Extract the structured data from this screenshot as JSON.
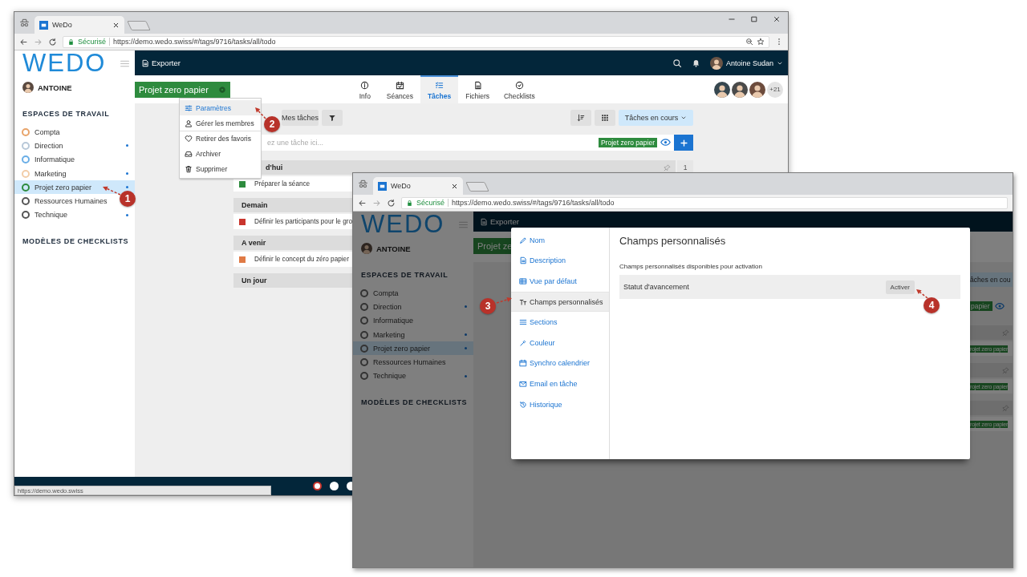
{
  "browser_1": {
    "tab": {
      "title": "WeDo"
    },
    "address_bar": {
      "security": "Sécurisé",
      "url": "https://demo.wedo.swiss/#/tags/9716/tasks/all/todo"
    },
    "sidebar": {
      "logo": "WEDO",
      "user": "ANTOINE",
      "section_title": "ESPACES DE TRAVAIL",
      "items": [
        {
          "label": "Compta",
          "color": "#e8a46a",
          "unread": false,
          "selected": false
        },
        {
          "label": "Direction",
          "color": "#b8c8d8",
          "unread": true,
          "selected": false
        },
        {
          "label": "Informatique",
          "color": "#6aaee6",
          "unread": false,
          "selected": false
        },
        {
          "label": "Marketing",
          "color": "#f2cda8",
          "unread": true,
          "selected": false
        },
        {
          "label": "Projet zero papier",
          "color": "#2e8b3e",
          "unread": true,
          "selected": true
        },
        {
          "label": "Ressources Humaines",
          "color": "#555555",
          "unread": false,
          "selected": false
        },
        {
          "label": "Technique",
          "color": "#555555",
          "unread": true,
          "selected": false
        }
      ],
      "footer_title": "MODÈLES DE CHECKLISTS"
    },
    "topbar": {
      "export": "Exporter",
      "user": "Antoine Sudan"
    },
    "project_tag": "Projet zero papier",
    "tabs": [
      {
        "label": "Info",
        "selected": false
      },
      {
        "label": "Séances",
        "selected": false
      },
      {
        "label": "Tâches",
        "selected": true
      },
      {
        "label": "Fichiers",
        "selected": false
      },
      {
        "label": "Checklists",
        "selected": false
      }
    ],
    "members_more": "+21",
    "toolbar": {
      "my_tasks": "Mes tâches",
      "view_filter": "Tâches en cours"
    },
    "task_input": {
      "placeholder": "ez une tâche ici...",
      "tag": "Projet zero papier"
    },
    "sections": [
      {
        "title": "d'hui",
        "count": "1",
        "tasks": [
          {
            "title": "Préparer la séance",
            "color": "#2e8b3e"
          }
        ]
      },
      {
        "title": "Demain",
        "tasks": [
          {
            "title": "Définir les participants pour le gro",
            "color": "#c9352d"
          }
        ]
      },
      {
        "title": "A venir",
        "tasks": [
          {
            "title": "Définir le concept du zéro papier",
            "color": "#e07a45"
          }
        ]
      },
      {
        "title": "Un jour"
      }
    ],
    "menu": [
      {
        "label": "Paramètres",
        "selected": true,
        "divider_before": false
      },
      {
        "label": "Gérer les membres",
        "selected": false,
        "divider_before": false
      },
      {
        "label": "Retirer des favoris",
        "selected": false,
        "divider_before": true
      },
      {
        "label": "Archiver",
        "selected": false,
        "divider_before": false
      },
      {
        "label": "Supprimer",
        "selected": false,
        "divider_before": false
      }
    ],
    "status_url": "https://demo.wedo.swiss"
  },
  "browser_2": {
    "tab": {
      "title": "WeDo"
    },
    "address_bar": {
      "security": "Sécurisé",
      "url": "https://demo.wedo.swiss/#/tags/9716/tasks/all/todo"
    },
    "sidebar": {
      "logo": "WEDO",
      "user": "ANTOINE",
      "section_title": "ESPACES DE TRAVAIL",
      "items": [
        {
          "label": "Compta",
          "unread": false,
          "selected": false
        },
        {
          "label": "Direction",
          "unread": true,
          "selected": false
        },
        {
          "label": "Informatique",
          "unread": false,
          "selected": false
        },
        {
          "label": "Marketing",
          "unread": true,
          "selected": false
        },
        {
          "label": "Projet zero papier",
          "unread": true,
          "selected": true
        },
        {
          "label": "Ressources Humaines",
          "unread": false,
          "selected": false
        },
        {
          "label": "Technique",
          "unread": true,
          "selected": false
        }
      ],
      "footer_title": "MODÈLES DE CHECKLISTS"
    },
    "topbar": {
      "export": "Exporter"
    },
    "project_tag": "Projet ze",
    "side_strip": {
      "view_filter": "âches en cou",
      "tag": "papier",
      "task_tags": [
        "rojet zero papier",
        "rojet zero papier",
        "rojet zero papier"
      ]
    },
    "dialog": {
      "nav": [
        {
          "label": "Nom",
          "selected": false
        },
        {
          "label": "Description",
          "selected": false
        },
        {
          "label": "Vue par défaut",
          "selected": false
        },
        {
          "label": "Champs personnalisés",
          "selected": true
        },
        {
          "label": "Sections",
          "selected": false
        },
        {
          "label": "Couleur",
          "selected": false
        },
        {
          "label": "Synchro calendrier",
          "selected": false
        },
        {
          "label": "Email en tâche",
          "selected": false
        },
        {
          "label": "Historique",
          "selected": false
        }
      ],
      "title": "Champs personnalisés",
      "subtitle": "Champs personnalisés disponibles pour activation",
      "fields": [
        {
          "name": "Statut d'avancement",
          "action": "Activer"
        }
      ]
    }
  },
  "annotations": [
    {
      "number": "1"
    },
    {
      "number": "2"
    },
    {
      "number": "3"
    },
    {
      "number": "4"
    }
  ]
}
